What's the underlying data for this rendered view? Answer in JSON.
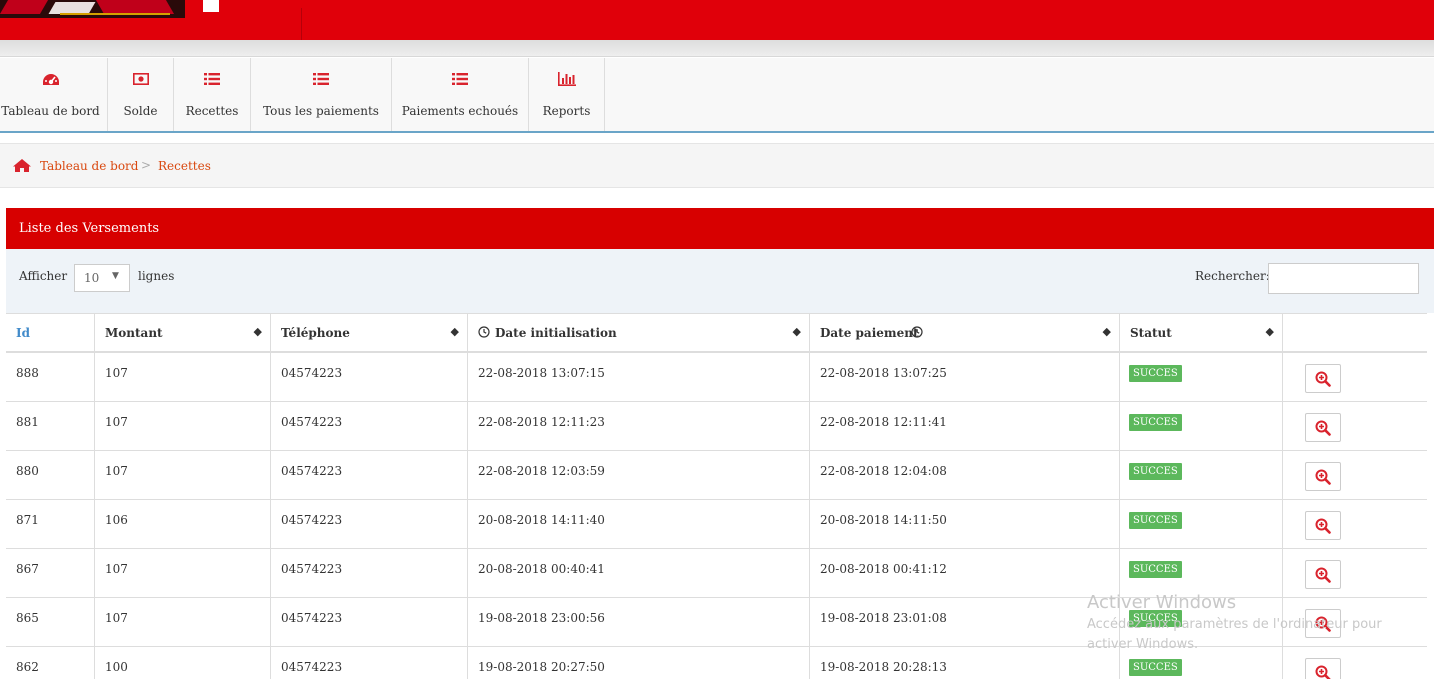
{
  "menu": [
    {
      "label": "Tableau de bord",
      "icon": "dashboard-icon"
    },
    {
      "label": "Solde",
      "icon": "money-icon"
    },
    {
      "label": "Recettes",
      "icon": "list-icon"
    },
    {
      "label": "Tous les paiements",
      "icon": "list-icon"
    },
    {
      "label": "Paiements echoués",
      "icon": "list-icon"
    },
    {
      "label": "Reports",
      "icon": "bar-chart-icon"
    }
  ],
  "breadcrumb": {
    "home": "Tableau de bord",
    "separator": ">",
    "current": "Recettes"
  },
  "panel": {
    "title": "Liste des Versements"
  },
  "controls": {
    "show_label": "Afficher",
    "length_value": "10",
    "rows_label": "lignes",
    "search_label": "Rechercher:",
    "search_value": ""
  },
  "table": {
    "headers": [
      "Id",
      "Montant",
      "Téléphone",
      "Date initialisation",
      "Date paiement",
      "Statut"
    ],
    "rows": [
      {
        "id": "888",
        "montant": "107",
        "telephone": "04574223",
        "date_init": "22-08-2018 13:07:15",
        "date_paiement": "22-08-2018 13:07:25",
        "statut": "SUCCES"
      },
      {
        "id": "881",
        "montant": "107",
        "telephone": "04574223",
        "date_init": "22-08-2018 12:11:23",
        "date_paiement": "22-08-2018 12:11:41",
        "statut": "SUCCES"
      },
      {
        "id": "880",
        "montant": "107",
        "telephone": "04574223",
        "date_init": "22-08-2018 12:03:59",
        "date_paiement": "22-08-2018 12:04:08",
        "statut": "SUCCES"
      },
      {
        "id": "871",
        "montant": "106",
        "telephone": "04574223",
        "date_init": "20-08-2018 14:11:40",
        "date_paiement": "20-08-2018 14:11:50",
        "statut": "SUCCES"
      },
      {
        "id": "867",
        "montant": "107",
        "telephone": "04574223",
        "date_init": "20-08-2018 00:40:41",
        "date_paiement": "20-08-2018 00:41:12",
        "statut": "SUCCES"
      },
      {
        "id": "865",
        "montant": "107",
        "telephone": "04574223",
        "date_init": "19-08-2018 23:00:56",
        "date_paiement": "19-08-2018 23:01:08",
        "statut": "SUCCES"
      },
      {
        "id": "862",
        "montant": "100",
        "telephone": "04574223",
        "date_init": "19-08-2018 20:27:50",
        "date_paiement": "19-08-2018 20:28:13",
        "statut": "SUCCES"
      }
    ]
  },
  "watermark": {
    "line1": "Activer Windows",
    "line2": "Accédez aux paramètres de l'ordinateur pour activer Windows."
  },
  "colors": {
    "header_red": "#e0000a",
    "panel_red": "#d70000",
    "success_green": "#5cb85c",
    "link_orange": "#d9480f",
    "icon_red": "#d9232d"
  }
}
